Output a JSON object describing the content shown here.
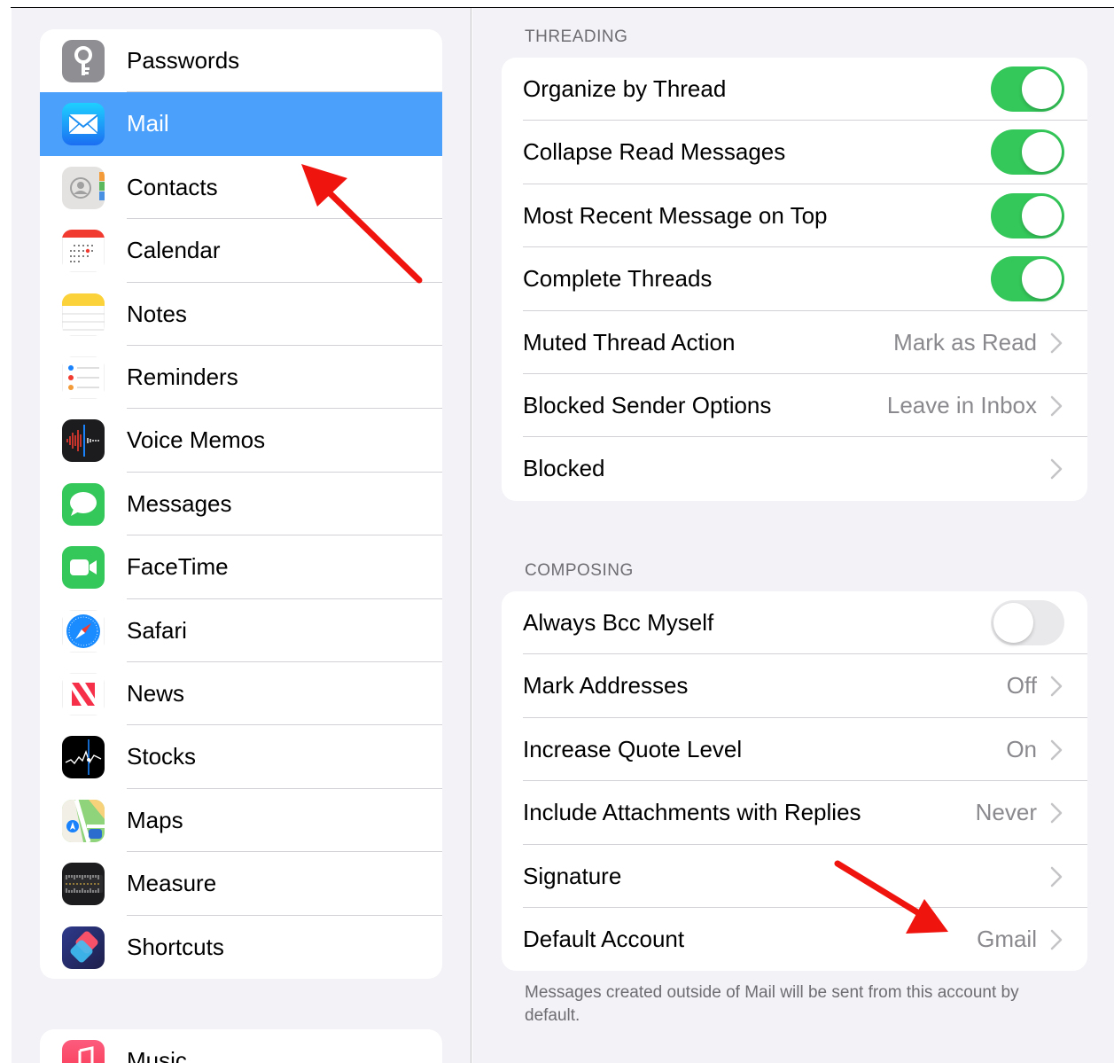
{
  "sidebar": {
    "items": [
      {
        "label": "Passwords",
        "icon": "key-icon",
        "selected": false
      },
      {
        "label": "Mail",
        "icon": "mail-icon",
        "selected": true
      },
      {
        "label": "Contacts",
        "icon": "contacts-icon",
        "selected": false
      },
      {
        "label": "Calendar",
        "icon": "calendar-icon",
        "selected": false
      },
      {
        "label": "Notes",
        "icon": "notes-icon",
        "selected": false
      },
      {
        "label": "Reminders",
        "icon": "reminders-icon",
        "selected": false
      },
      {
        "label": "Voice Memos",
        "icon": "voice-memos-icon",
        "selected": false
      },
      {
        "label": "Messages",
        "icon": "messages-icon",
        "selected": false
      },
      {
        "label": "FaceTime",
        "icon": "facetime-icon",
        "selected": false
      },
      {
        "label": "Safari",
        "icon": "safari-icon",
        "selected": false
      },
      {
        "label": "News",
        "icon": "news-icon",
        "selected": false
      },
      {
        "label": "Stocks",
        "icon": "stocks-icon",
        "selected": false
      },
      {
        "label": "Maps",
        "icon": "maps-icon",
        "selected": false
      },
      {
        "label": "Measure",
        "icon": "measure-icon",
        "selected": false
      },
      {
        "label": "Shortcuts",
        "icon": "shortcuts-icon",
        "selected": false
      }
    ],
    "group2_items": [
      {
        "label": "Music",
        "icon": "music-icon"
      }
    ]
  },
  "threading": {
    "header": "THREADING",
    "rows": [
      {
        "label": "Organize by Thread",
        "toggle": true
      },
      {
        "label": "Collapse Read Messages",
        "toggle": true
      },
      {
        "label": "Most Recent Message on Top",
        "toggle": true
      },
      {
        "label": "Complete Threads",
        "toggle": true
      },
      {
        "label": "Muted Thread Action",
        "value": "Mark as Read"
      },
      {
        "label": "Blocked Sender Options",
        "value": "Leave in Inbox"
      },
      {
        "label": "Blocked",
        "value": ""
      }
    ]
  },
  "composing": {
    "header": "COMPOSING",
    "rows": [
      {
        "label": "Always Bcc Myself",
        "toggle": false
      },
      {
        "label": "Mark Addresses",
        "value": "Off"
      },
      {
        "label": "Increase Quote Level",
        "value": "On"
      },
      {
        "label": "Include Attachments with Replies",
        "value": "Never"
      },
      {
        "label": "Signature",
        "value": ""
      },
      {
        "label": "Default Account",
        "value": "Gmail"
      }
    ],
    "footer": "Messages created outside of Mail will be sent from this account by default."
  },
  "colors": {
    "selected_row": "#4aa0fb",
    "toggle_on": "#34c759",
    "toggle_off": "#e9e9eb",
    "annotation_arrow": "#f0140f"
  }
}
